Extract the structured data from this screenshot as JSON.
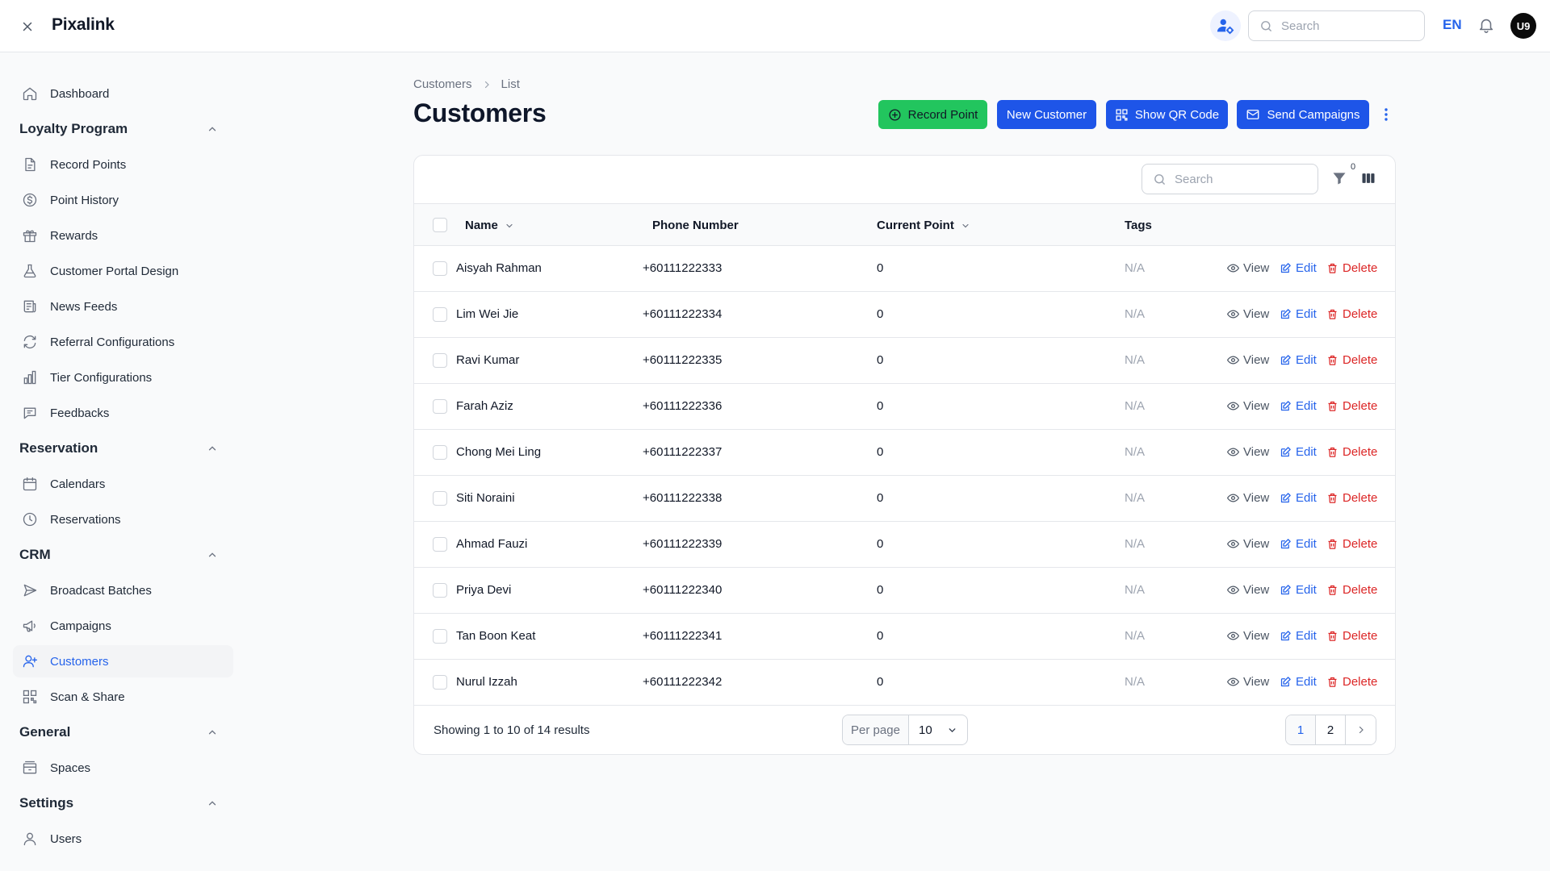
{
  "app": {
    "brand": "Pixalink"
  },
  "topbar": {
    "search_placeholder": "Search",
    "language": "EN",
    "avatar_initials": "U9"
  },
  "sidebar": {
    "dashboard": "Dashboard",
    "groups": {
      "loyalty": "Loyalty Program",
      "reservation": "Reservation",
      "crm": "CRM",
      "general": "General",
      "settings": "Settings"
    },
    "items": {
      "record_points": "Record Points",
      "point_history": "Point History",
      "rewards": "Rewards",
      "portal_design": "Customer Portal Design",
      "news_feeds": "News Feeds",
      "referral": "Referral Configurations",
      "tier": "Tier Configurations",
      "feedbacks": "Feedbacks",
      "calendars": "Calendars",
      "reservations": "Reservations",
      "broadcast": "Broadcast Batches",
      "campaigns": "Campaigns",
      "customers": "Customers",
      "scan_share": "Scan & Share",
      "spaces": "Spaces",
      "users": "Users"
    }
  },
  "page": {
    "breadcrumb": [
      "Customers",
      "List"
    ],
    "title": "Customers",
    "actions": {
      "record_point": "Record Point",
      "new_customer": "New Customer",
      "show_qr": "Show QR Code",
      "send_campaigns": "Send Campaigns"
    }
  },
  "table": {
    "search_placeholder": "Search",
    "filter_count": "0",
    "columns": {
      "name": "Name",
      "phone": "Phone Number",
      "points": "Current Point",
      "tags": "Tags"
    },
    "row_actions": {
      "view": "View",
      "edit": "Edit",
      "delete": "Delete"
    },
    "rows": [
      {
        "name": "Aisyah Rahman",
        "phone": "+60111222333",
        "points": "0",
        "tags": "N/A"
      },
      {
        "name": "Lim Wei Jie",
        "phone": "+60111222334",
        "points": "0",
        "tags": "N/A"
      },
      {
        "name": "Ravi Kumar",
        "phone": "+60111222335",
        "points": "0",
        "tags": "N/A"
      },
      {
        "name": "Farah Aziz",
        "phone": "+60111222336",
        "points": "0",
        "tags": "N/A"
      },
      {
        "name": "Chong Mei Ling",
        "phone": "+60111222337",
        "points": "0",
        "tags": "N/A"
      },
      {
        "name": "Siti Noraini",
        "phone": "+60111222338",
        "points": "0",
        "tags": "N/A"
      },
      {
        "name": "Ahmad Fauzi",
        "phone": "+60111222339",
        "points": "0",
        "tags": "N/A"
      },
      {
        "name": "Priya Devi",
        "phone": "+60111222340",
        "points": "0",
        "tags": "N/A"
      },
      {
        "name": "Tan Boon Keat",
        "phone": "+60111222341",
        "points": "0",
        "tags": "N/A"
      },
      {
        "name": "Nurul Izzah",
        "phone": "+60111222342",
        "points": "0",
        "tags": "N/A"
      }
    ],
    "footer": {
      "summary": "Showing 1 to 10 of 14 results",
      "per_page_label": "Per page",
      "per_page_value": "10",
      "pages": [
        "1",
        "2"
      ],
      "current_page": "1"
    }
  },
  "colors": {
    "accent": "#2563eb",
    "success": "#22c55e",
    "danger": "#dc2626"
  }
}
